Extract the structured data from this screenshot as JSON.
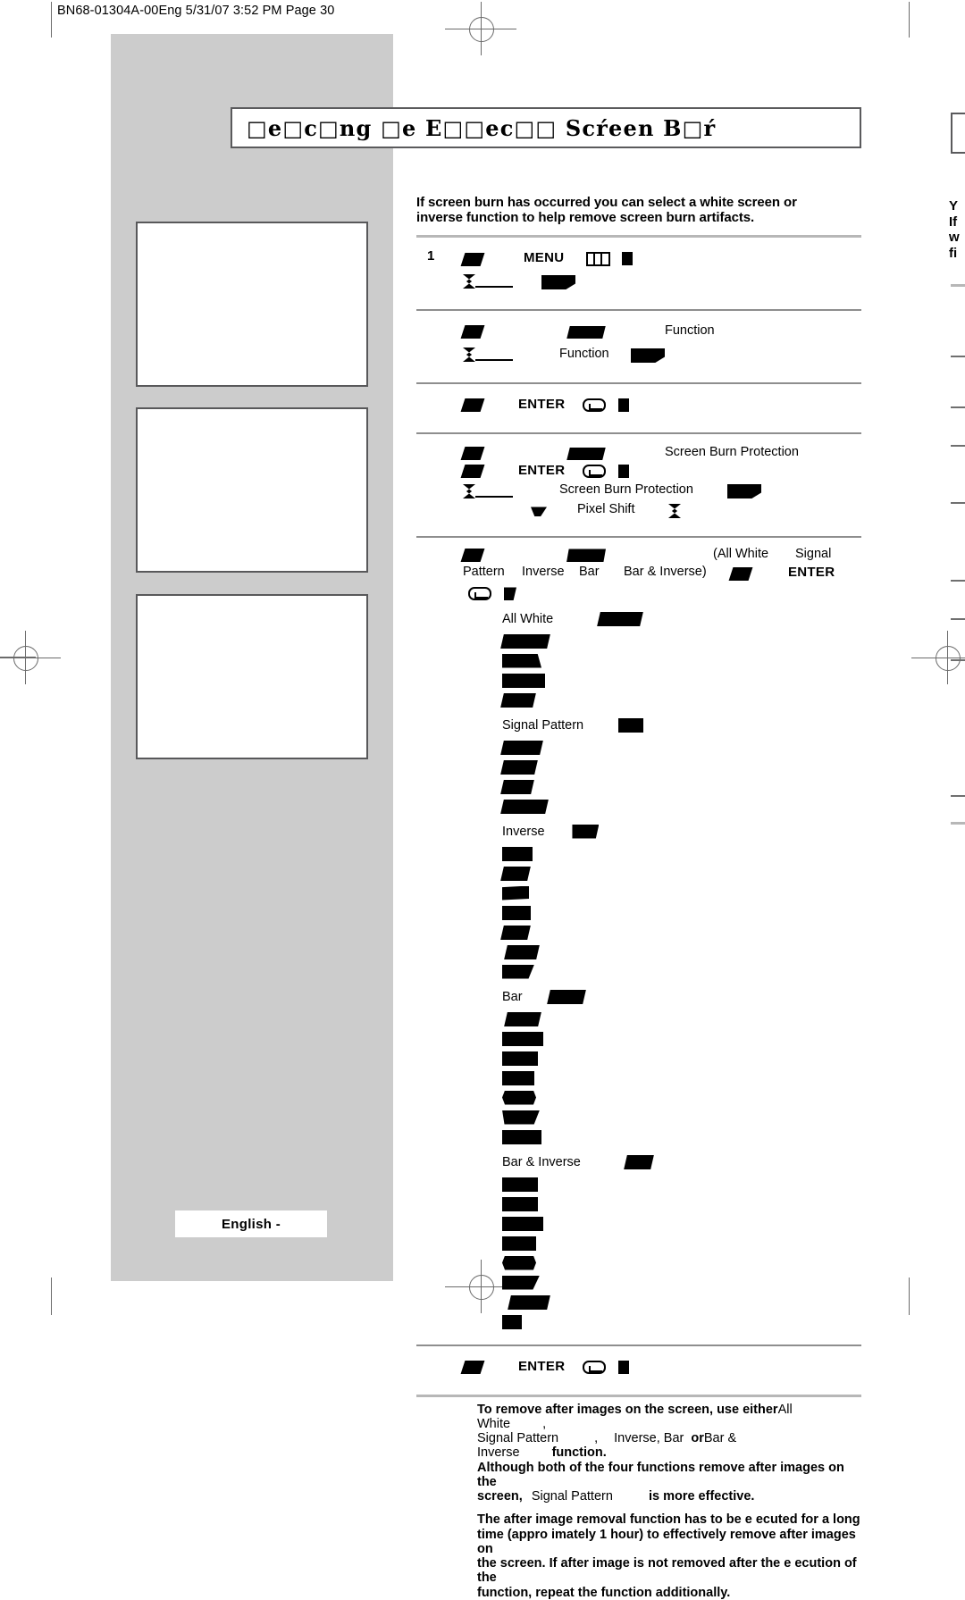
{
  "page": {
    "header_line": "BN68-01304A-00Eng  5/31/07  3:52 PM  Page 30",
    "language_footer": "English -",
    "title": "□e□c□ng □e E□□ec□□ Scŕeen B□ŕ"
  },
  "intro": {
    "line1": "If screen burn has occurred  you can select a white screen or",
    "line2": "inverse function to help remove screen burn artifacts."
  },
  "steps": [
    {
      "number": "1",
      "keyword": "MENU",
      "icon": "menu-key-icon",
      "sub_text": ""
    },
    {
      "number": "",
      "keyword": "",
      "label_right": "Function",
      "sub_label": "Function"
    },
    {
      "number": "",
      "keyword": "ENTER",
      "icon": "enter-key-icon"
    },
    {
      "number": "",
      "keyword": "ENTER",
      "label_right": "Screen Burn Protection",
      "sub_label": "Screen Burn Protection",
      "sub_label2": "Pixel Shift"
    }
  ],
  "options_row": {
    "pattern": "Pattern",
    "inverse": "Inverse",
    "bar": "Bar",
    "bar_inverse": "Bar & Inverse)",
    "all_white": "(All White",
    "signal": "Signal",
    "enter": "ENTER"
  },
  "option_groups": [
    {
      "label": "All White",
      "bars": [
        52,
        62,
        58,
        58,
        42
      ],
      "head_bar": 48
    },
    {
      "label": "Signal Pattern",
      "bars": [
        46,
        42,
        38,
        52
      ],
      "head_bar": 28
    },
    {
      "label": "Inverse",
      "bars": [
        34,
        32,
        30,
        34,
        32,
        38,
        36
      ],
      "head_bar": 30
    },
    {
      "label": "Bar",
      "bars": [
        38,
        46,
        40,
        46,
        38,
        42,
        44,
        42
      ],
      "head_bar": 40
    },
    {
      "label": "Bar & Inverse",
      "bars": [
        40,
        40,
        48,
        38,
        38,
        42,
        48,
        22
      ],
      "head_bar": 32
    }
  ],
  "final_step": {
    "keyword": "ENTER",
    "icon": "enter-key-icon"
  },
  "bottom_note": {
    "p1_a": "To remove after images on the screen, use either",
    "p1_all_white": "All White",
    "p1_b": ",",
    "p1_signal": "Signal Pattern",
    "p1_c": ",",
    "p1_inverse": "Inverse",
    "p1_d": ", Bar",
    "p1_or": "or",
    "p1_bar_inverse": "Bar & Inverse",
    "p1_e": "function.",
    "p1_f": "Although both of the four functions remove after images on the",
    "p1_g": "screen,",
    "p1_signal2": "Signal Pattern",
    "p1_h": "is more effective.",
    "p2_line1": "The after image removal function has to be e  ecuted for a long",
    "p2_line2": "time (appro  imately 1 hour) to effectively remove after images on",
    "p2_line3": "the screen. If after image is not removed after the e  ecution of the",
    "p2_line4": "function, repeat the function additionally."
  },
  "right_column": {
    "l1": "Y",
    "l2": "If",
    "l3": "w",
    "l4": "fi"
  },
  "colors": {
    "panel_gray": "#cccccc",
    "rule_gray": "#b7b7b7",
    "border_gray": "#58585a",
    "text": "#000000"
  }
}
